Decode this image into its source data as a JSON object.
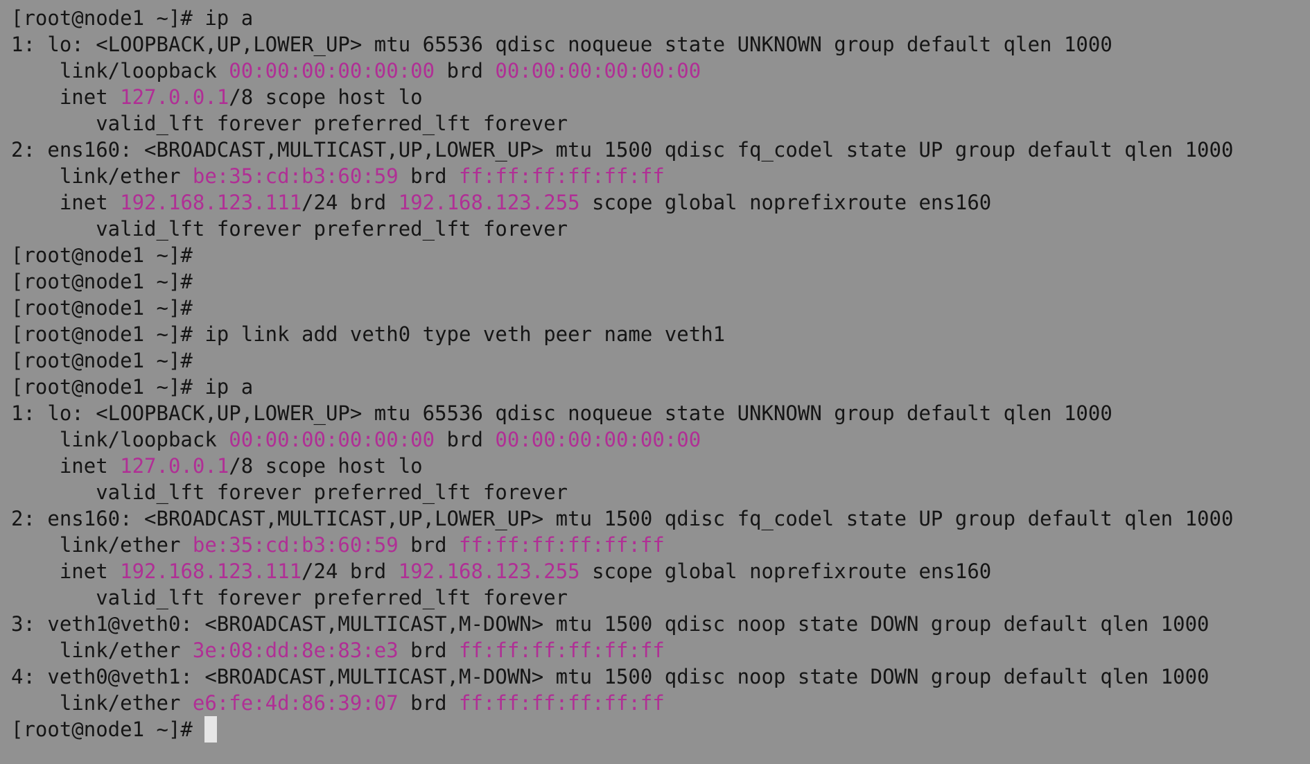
{
  "terminal": {
    "colors": {
      "background": "#919191",
      "text": "#151515",
      "highlight": "#b02f95",
      "cursor": "#e6e6e6"
    },
    "lines": [
      [
        {
          "t": "[root@node1 ~]# ip a"
        }
      ],
      [
        {
          "t": "1: lo: <LOOPBACK,UP,LOWER_UP> mtu 65536 qdisc noqueue state UNKNOWN group default qlen 1000"
        }
      ],
      [
        {
          "t": "    link/loopback "
        },
        {
          "t": "00:00:00:00:00:00",
          "h": true
        },
        {
          "t": " brd "
        },
        {
          "t": "00:00:00:00:00:00",
          "h": true
        }
      ],
      [
        {
          "t": "    inet "
        },
        {
          "t": "127.0.0.1",
          "h": true
        },
        {
          "t": "/8 scope host lo"
        }
      ],
      [
        {
          "t": "       valid_lft forever preferred_lft forever"
        }
      ],
      [
        {
          "t": "2: ens160: <BROADCAST,MULTICAST,UP,LOWER_UP> mtu 1500 qdisc fq_codel state UP group default qlen 1000"
        }
      ],
      [
        {
          "t": "    link/ether "
        },
        {
          "t": "be:35:cd:b3:60:59",
          "h": true
        },
        {
          "t": " brd "
        },
        {
          "t": "ff:ff:ff:ff:ff:ff",
          "h": true
        }
      ],
      [
        {
          "t": "    inet "
        },
        {
          "t": "192.168.123.111",
          "h": true
        },
        {
          "t": "/24 brd "
        },
        {
          "t": "192.168.123.255",
          "h": true
        },
        {
          "t": " scope global noprefixroute ens160"
        }
      ],
      [
        {
          "t": "       valid_lft forever preferred_lft forever"
        }
      ],
      [
        {
          "t": "[root@node1 ~]#"
        }
      ],
      [
        {
          "t": "[root@node1 ~]#"
        }
      ],
      [
        {
          "t": "[root@node1 ~]#"
        }
      ],
      [
        {
          "t": "[root@node1 ~]# ip link add veth0 type veth peer name veth1"
        }
      ],
      [
        {
          "t": "[root@node1 ~]#"
        }
      ],
      [
        {
          "t": "[root@node1 ~]# ip a"
        }
      ],
      [
        {
          "t": "1: lo: <LOOPBACK,UP,LOWER_UP> mtu 65536 qdisc noqueue state UNKNOWN group default qlen 1000"
        }
      ],
      [
        {
          "t": "    link/loopback "
        },
        {
          "t": "00:00:00:00:00:00",
          "h": true
        },
        {
          "t": " brd "
        },
        {
          "t": "00:00:00:00:00:00",
          "h": true
        }
      ],
      [
        {
          "t": "    inet "
        },
        {
          "t": "127.0.0.1",
          "h": true
        },
        {
          "t": "/8 scope host lo"
        }
      ],
      [
        {
          "t": "       valid_lft forever preferred_lft forever"
        }
      ],
      [
        {
          "t": "2: ens160: <BROADCAST,MULTICAST,UP,LOWER_UP> mtu 1500 qdisc fq_codel state UP group default qlen 1000"
        }
      ],
      [
        {
          "t": "    link/ether "
        },
        {
          "t": "be:35:cd:b3:60:59",
          "h": true
        },
        {
          "t": " brd "
        },
        {
          "t": "ff:ff:ff:ff:ff:ff",
          "h": true
        }
      ],
      [
        {
          "t": "    inet "
        },
        {
          "t": "192.168.123.111",
          "h": true
        },
        {
          "t": "/24 brd "
        },
        {
          "t": "192.168.123.255",
          "h": true
        },
        {
          "t": " scope global noprefixroute ens160"
        }
      ],
      [
        {
          "t": "       valid_lft forever preferred_lft forever"
        }
      ],
      [
        {
          "t": "3: veth1@veth0: <BROADCAST,MULTICAST,M-DOWN> mtu 1500 qdisc noop state DOWN group default qlen 1000"
        }
      ],
      [
        {
          "t": "    link/ether "
        },
        {
          "t": "3e:08:dd:8e:83:e3",
          "h": true
        },
        {
          "t": " brd "
        },
        {
          "t": "ff:ff:ff:ff:ff:ff",
          "h": true
        }
      ],
      [
        {
          "t": "4: veth0@veth1: <BROADCAST,MULTICAST,M-DOWN> mtu 1500 qdisc noop state DOWN group default qlen 1000"
        }
      ],
      [
        {
          "t": "    link/ether "
        },
        {
          "t": "e6:fe:4d:86:39:07",
          "h": true
        },
        {
          "t": " brd "
        },
        {
          "t": "ff:ff:ff:ff:ff:ff",
          "h": true
        }
      ],
      [
        {
          "t": "[root@node1 ~]# "
        },
        {
          "cursor": true
        }
      ]
    ]
  }
}
